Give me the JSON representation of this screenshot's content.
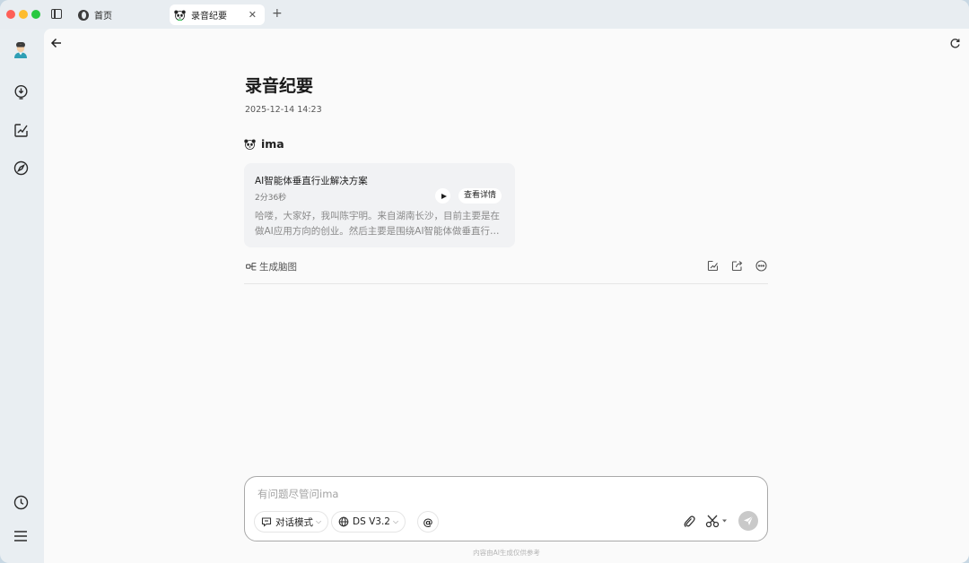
{
  "tabs": [
    {
      "label": "首页",
      "icon": "ima-logo-icon",
      "active": false
    },
    {
      "label": "录音纪要",
      "icon": "panda-icon",
      "active": true,
      "close_glyph": "✕"
    }
  ],
  "new_tab_glyph": "+",
  "rail": {
    "items": [
      "avatar",
      "lightbulb-icon",
      "edit-chart-icon",
      "compass-icon",
      "history-icon",
      "menu-icon"
    ]
  },
  "page": {
    "title": "录音纪要",
    "date": "2025-12-14 14:23"
  },
  "author": {
    "icon_glyph": "🐼",
    "name": "ima"
  },
  "recording_card": {
    "title": "AI智能体垂直行业解决方案",
    "duration": "2分36秒",
    "detail_label": "查看详情",
    "excerpt_line1": "哈喽，大家好，我叫陈宇明。来自湖南长沙，目前主要是在",
    "excerpt_line2": "做AI应用方向的创业。然后主要是围绕AI智能体做垂直行…"
  },
  "actions": {
    "mindmap_label": "生成脑图",
    "icons": [
      "edit-icon",
      "share-icon",
      "more-icon"
    ]
  },
  "composer": {
    "placeholder": "有问题尽管问ima",
    "value": "",
    "mode_label": "对话模式",
    "model_label": "DS V3.2",
    "at_label": "@"
  },
  "disclaimer": "内容由AI生成仅供参考",
  "colors": {
    "send_disabled": "#c9c9c9",
    "traffic_red": "#fe5f57",
    "traffic_yellow": "#febc2e",
    "traffic_green": "#28c840"
  }
}
